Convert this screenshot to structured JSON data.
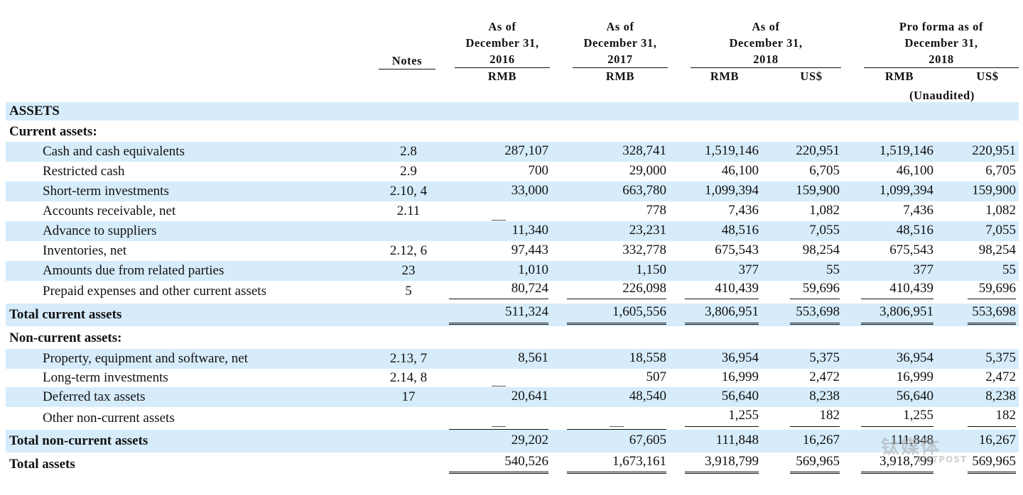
{
  "header": {
    "notes": "Notes",
    "col_2016": {
      "l1": "As of",
      "l2": "December 31,",
      "l3": "2016",
      "cur": "RMB"
    },
    "col_2017": {
      "l1": "As of",
      "l2": "December 31,",
      "l3": "2017",
      "cur": "RMB"
    },
    "col_2018": {
      "l1": "As of",
      "l2": "December 31,",
      "l3": "2018",
      "cur_rmb": "RMB",
      "cur_usd": "US$"
    },
    "col_pro": {
      "l1": "Pro forma as of",
      "l2": "December 31,",
      "l3": "2018",
      "cur_rmb": "RMB",
      "cur_usd": "US$",
      "note": "(Unaudited)"
    }
  },
  "rows": [
    {
      "label": "ASSETS",
      "note": "",
      "v": [
        "",
        "",
        "",
        "",
        "",
        ""
      ]
    },
    {
      "label": "Current assets:",
      "note": "",
      "v": [
        "",
        "",
        "",
        "",
        "",
        ""
      ]
    },
    {
      "label": "Cash and cash equivalents",
      "note": "2.8",
      "v": [
        "287,107",
        "328,741",
        "1,519,146",
        "220,951",
        "1,519,146",
        "220,951"
      ]
    },
    {
      "label": "Restricted cash",
      "note": "2.9",
      "v": [
        "700",
        "29,000",
        "46,100",
        "6,705",
        "46,100",
        "6,705"
      ]
    },
    {
      "label": "Short-term investments",
      "note": "2.10, 4",
      "v": [
        "33,000",
        "663,780",
        "1,099,394",
        "159,900",
        "1,099,394",
        "159,900"
      ]
    },
    {
      "label": "Accounts receivable, net",
      "note": "2.11",
      "v": [
        "—",
        "778",
        "7,436",
        "1,082",
        "7,436",
        "1,082"
      ]
    },
    {
      "label": "Advance to suppliers",
      "note": "",
      "v": [
        "11,340",
        "23,231",
        "48,516",
        "7,055",
        "48,516",
        "7,055"
      ]
    },
    {
      "label": "Inventories, net",
      "note": "2.12, 6",
      "v": [
        "97,443",
        "332,778",
        "675,543",
        "98,254",
        "675,543",
        "98,254"
      ]
    },
    {
      "label": "Amounts due from related parties",
      "note": "23",
      "v": [
        "1,010",
        "1,150",
        "377",
        "55",
        "377",
        "55"
      ]
    },
    {
      "label": "Prepaid expenses and other current assets",
      "note": "5",
      "v": [
        "80,724",
        "226,098",
        "410,439",
        "59,696",
        "410,439",
        "59,696"
      ]
    },
    {
      "label": "Total current assets",
      "note": "",
      "v": [
        "511,324",
        "1,605,556",
        "3,806,951",
        "553,698",
        "3,806,951",
        "553,698"
      ]
    },
    {
      "label": "Non-current assets:",
      "note": "",
      "v": [
        "",
        "",
        "",
        "",
        "",
        ""
      ]
    },
    {
      "label": "Property, equipment and software, net",
      "note": "2.13, 7",
      "v": [
        "8,561",
        "18,558",
        "36,954",
        "5,375",
        "36,954",
        "5,375"
      ]
    },
    {
      "label": "Long-term investments",
      "note": "2.14, 8",
      "v": [
        "—",
        "507",
        "16,999",
        "2,472",
        "16,999",
        "2,472"
      ]
    },
    {
      "label": "Deferred tax assets",
      "note": "17",
      "v": [
        "20,641",
        "48,540",
        "56,640",
        "8,238",
        "56,640",
        "8,238"
      ]
    },
    {
      "label": "Other non-current assets",
      "note": "",
      "v": [
        "—",
        "—",
        "1,255",
        "182",
        "1,255",
        "182"
      ]
    },
    {
      "label": "Total non-current assets",
      "note": "",
      "v": [
        "29,202",
        "67,605",
        "111,848",
        "16,267",
        "111,848",
        "16,267"
      ]
    },
    {
      "label": "Total assets",
      "note": "",
      "v": [
        "540,526",
        "1,673,161",
        "3,918,799",
        "569,965",
        "3,918,799",
        "569,965"
      ]
    }
  ],
  "watermark": {
    "main": "钛媒体",
    "sub": "TMTPOST"
  }
}
